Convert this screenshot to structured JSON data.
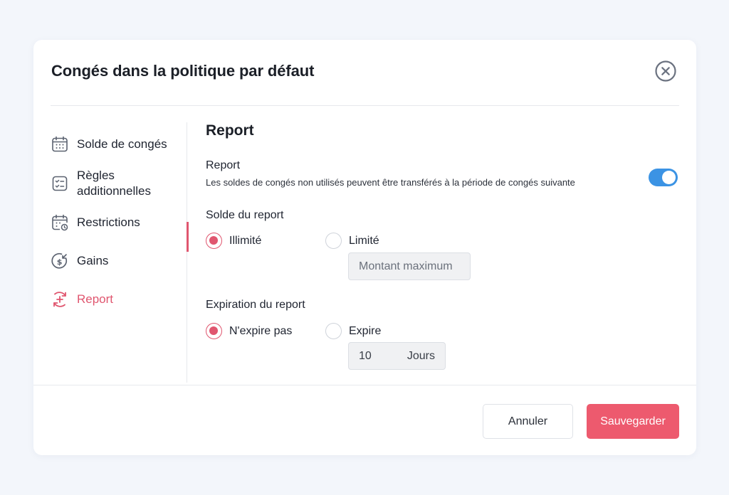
{
  "modal": {
    "title": "Congés dans la politique par défaut"
  },
  "sidebar": {
    "items": [
      {
        "label": "Solde de congés",
        "icon": "calendar-icon"
      },
      {
        "label": "Règles\nadditionnelles",
        "icon": "checklist-icon"
      },
      {
        "label": "Restrictions",
        "icon": "calendar-clock-icon"
      },
      {
        "label": "Gains",
        "icon": "dollar-cycle-icon"
      },
      {
        "label": "Report",
        "icon": "plus-cycle-icon",
        "active": true
      }
    ]
  },
  "content": {
    "section_title": "Report",
    "setting": {
      "title": "Report",
      "description": "Les soldes de congés non utilisés peuvent être transférés à la période de congés suivante",
      "enabled": true
    },
    "balance": {
      "label": "Solde du report",
      "option_unlimited": "Illimité",
      "option_limited": "Limité",
      "selected": "Illimité",
      "max_amount_placeholder": "Montant maximum"
    },
    "expiration": {
      "label": "Expiration du report",
      "option_never": "N'expire pas",
      "option_expires": "Expire",
      "selected": "N'expire pas",
      "days_value": "10",
      "days_unit": "Jours"
    }
  },
  "footer": {
    "cancel_label": "Annuler",
    "save_label": "Sauvegarder"
  },
  "colors": {
    "accent": "#e0566f",
    "save_button": "#ed5a6e",
    "toggle_on": "#3b93e4",
    "background": "#f3f6fb"
  }
}
